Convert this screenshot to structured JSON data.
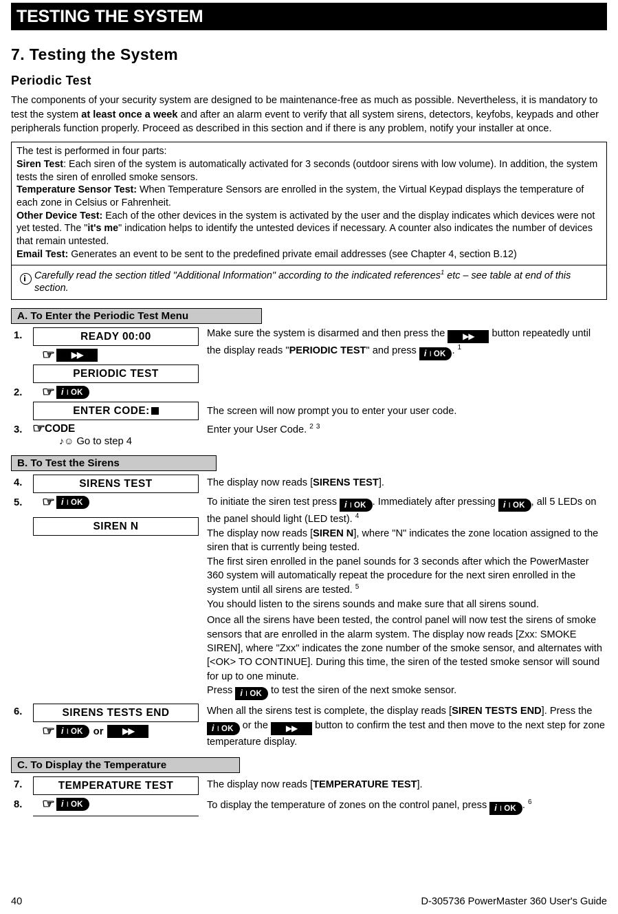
{
  "running_header": {
    "text": "TESTING THE SYSTEM"
  },
  "chapter": {
    "title": "7. Testing the System",
    "subtitle": "Periodic Test"
  },
  "intro": {
    "part1": "The components of your security system are designed to be maintenance-free as much as possible. Nevertheless, it is mandatory to test the system ",
    "bold1": "at least once a week",
    "part2": " and after an alarm event to verify that all system sirens, detectors, keyfobs, keypads and other peripherals function properly. Proceed as described in this section and if there is any problem, notify your installer at once."
  },
  "framed_box": {
    "lead": "The test is performed in four parts:",
    "siren_label": "Siren Test",
    "siren_text": ": Each siren of the system is automatically activated for 3 seconds (outdoor sirens with low volume). In addition, the system tests the siren of enrolled smoke sensors.",
    "temp_label": "Temperature Sensor Test:",
    "temp_text": " When Temperature Sensors are enrolled in the system, the Virtual Keypad displays the temperature of each zone in Celsius or Fahrenheit.",
    "other_label": "Other Device Test:",
    "other_text_a": " Each of the other devices in the system is activated by the user and the display indicates which devices were not yet tested. The \"",
    "other_bold": "it's me",
    "other_text_b": "\" indication helps to identify the untested devices if necessary. A counter also indicates the number of devices that remain untested.",
    "email_label": "Email Test:",
    "email_text": " Generates an event to be sent to the predefined private email addresses (see Chapter 4, section B.12)"
  },
  "note": {
    "icon": "info-circle-icon",
    "text_a": "Carefully read the section titled \"Additional Information\" according to the indicated references",
    "ref": "1",
    "text_b": " etc – see table at end of this section."
  },
  "keys": {
    "ok_info": "i",
    "ok_sep": "I",
    "ok_label": "OK",
    "next_arrow": "▶▶",
    "hand": "☞",
    "or": "or",
    "music_note": "♪",
    "smiley": "☺"
  },
  "sections": [
    {
      "id": "A",
      "bar": "A. To Enter the Periodic Test Menu"
    },
    {
      "id": "B",
      "bar": "B. To Test the Sirens"
    },
    {
      "id": "C",
      "bar": "C. To Display the Temperature"
    }
  ],
  "steps": {
    "s1": {
      "num": "1.",
      "lcd_top": "READY 00:00",
      "lcd_bottom": "PERIODIC TEST",
      "text_a": "Make sure the system is disarmed and then press the ",
      "text_b": " button repeatedly until the display reads \"",
      "bold": "PERIODIC TEST",
      "text_c": "\" and press ",
      "text_d": ".",
      "ref": "1"
    },
    "s2": {
      "num": "2.",
      "lcd": "ENTER CODE:",
      "text": "The screen will now prompt you to enter your user code."
    },
    "s3": {
      "num": "3.",
      "code_label": "CODE",
      "goto": "Go to step 4",
      "text": "Enter your User Code.",
      "ref1": "2",
      "ref2": "3"
    },
    "s4": {
      "num": "4.",
      "lcd": "SIRENS TEST",
      "text_a": "The display now reads [",
      "bold": "SIRENS TEST",
      "text_b": "]."
    },
    "s5": {
      "num": "5.",
      "lcd": "SIREN N",
      "p1_a": "To initiate the siren test press ",
      "p1_b": ". Immediately after pressing ",
      "p1_c": ", all 5 LEDs on the panel should light (LED test).",
      "p1_ref": "4",
      "p2_a": "The display now reads [",
      "p2_bold": "SIREN N",
      "p2_b": "], where \"N\" indicates the zone location assigned to the siren that is currently being tested.",
      "p3_a": "The first siren enrolled in the panel sounds for 3 seconds after which the PowerMaster 360 system will automatically repeat the procedure for the next siren enrolled in the system until all sirens are tested.",
      "p3_ref": "5",
      "p4": "You should listen to the sirens sounds and make sure that all sirens sound.",
      "p5": "Once all the sirens have been tested, the control panel will now test the sirens of smoke sensors that are enrolled in the alarm system. The display now reads [Zxx: SMOKE SIREN], where \"Zxx\" indicates the zone number of the smoke sensor, and alternates with [<OK> TO CONTINUE]. During this time, the siren of the tested smoke sensor will sound for up to one minute.",
      "p6_a": "Press ",
      "p6_b": " to test the siren of the next smoke sensor."
    },
    "s6": {
      "num": "6.",
      "lcd": "SIRENS TESTS END",
      "text_a": "When all the sirens test is complete, the display reads [",
      "bold": "SIREN TESTS END",
      "text_b": "]. Press the ",
      "text_c": " or the ",
      "text_d": " button to confirm the test and then move to the next step for zone temperature display."
    },
    "s7": {
      "num": "7.",
      "lcd": "TEMPERATURE TEST",
      "text_a": "The display now reads [",
      "bold": "TEMPERATURE TEST",
      "text_b": "]."
    },
    "s8": {
      "num": "8.",
      "text_a": "To display the temperature of zones on the control panel, press ",
      "text_b": ".",
      "ref": "6"
    }
  },
  "footer": {
    "page_number": "40",
    "doc_ref": "D-305736 PowerMaster 360 User's Guide"
  }
}
